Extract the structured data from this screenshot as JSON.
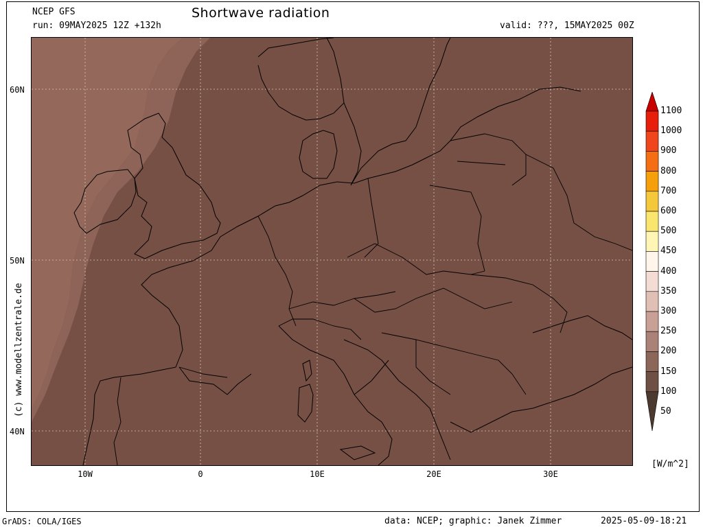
{
  "header": {
    "model": "NCEP GFS",
    "run": "run: 09MAY2025 12Z +132h",
    "title": "Shortwave radiation",
    "valid": "valid: ???, 15MAY2025 00Z"
  },
  "axes": {
    "lat_labels": [
      "60N",
      "50N",
      "40N"
    ],
    "lon_labels": [
      "10W",
      "0",
      "10E",
      "20E",
      "30E"
    ]
  },
  "colorbar": {
    "levels": [
      "1100",
      "1000",
      "900",
      "800",
      "700",
      "600",
      "500",
      "450",
      "400",
      "350",
      "300",
      "250",
      "200",
      "150",
      "100",
      "50"
    ],
    "colors": [
      "#c80000",
      "#e61e0a",
      "#f0461e",
      "#f56e14",
      "#f5a00a",
      "#f5c83c",
      "#fae66e",
      "#fff5b4",
      "#fff5ea",
      "#f2dcd3",
      "#e0c0b5",
      "#c8a096",
      "#aa8278",
      "#8c6658",
      "#6e5044",
      "#4c3930"
    ],
    "unit": "[W/m^2]"
  },
  "map": {
    "background_color": "#765045",
    "ocean_edge_color": "#8d6457",
    "ocean_far_color": "#94695c",
    "coast_color": "#000000",
    "grid_color": "#d8c7b8"
  },
  "footer": {
    "left": "GrADS: COLA/IGES",
    "center": "data: NCEP; graphic: Janek Zimmer",
    "right": "2025-05-09-18:21"
  },
  "side_credit": "(c) www.modellzentrale.de"
}
